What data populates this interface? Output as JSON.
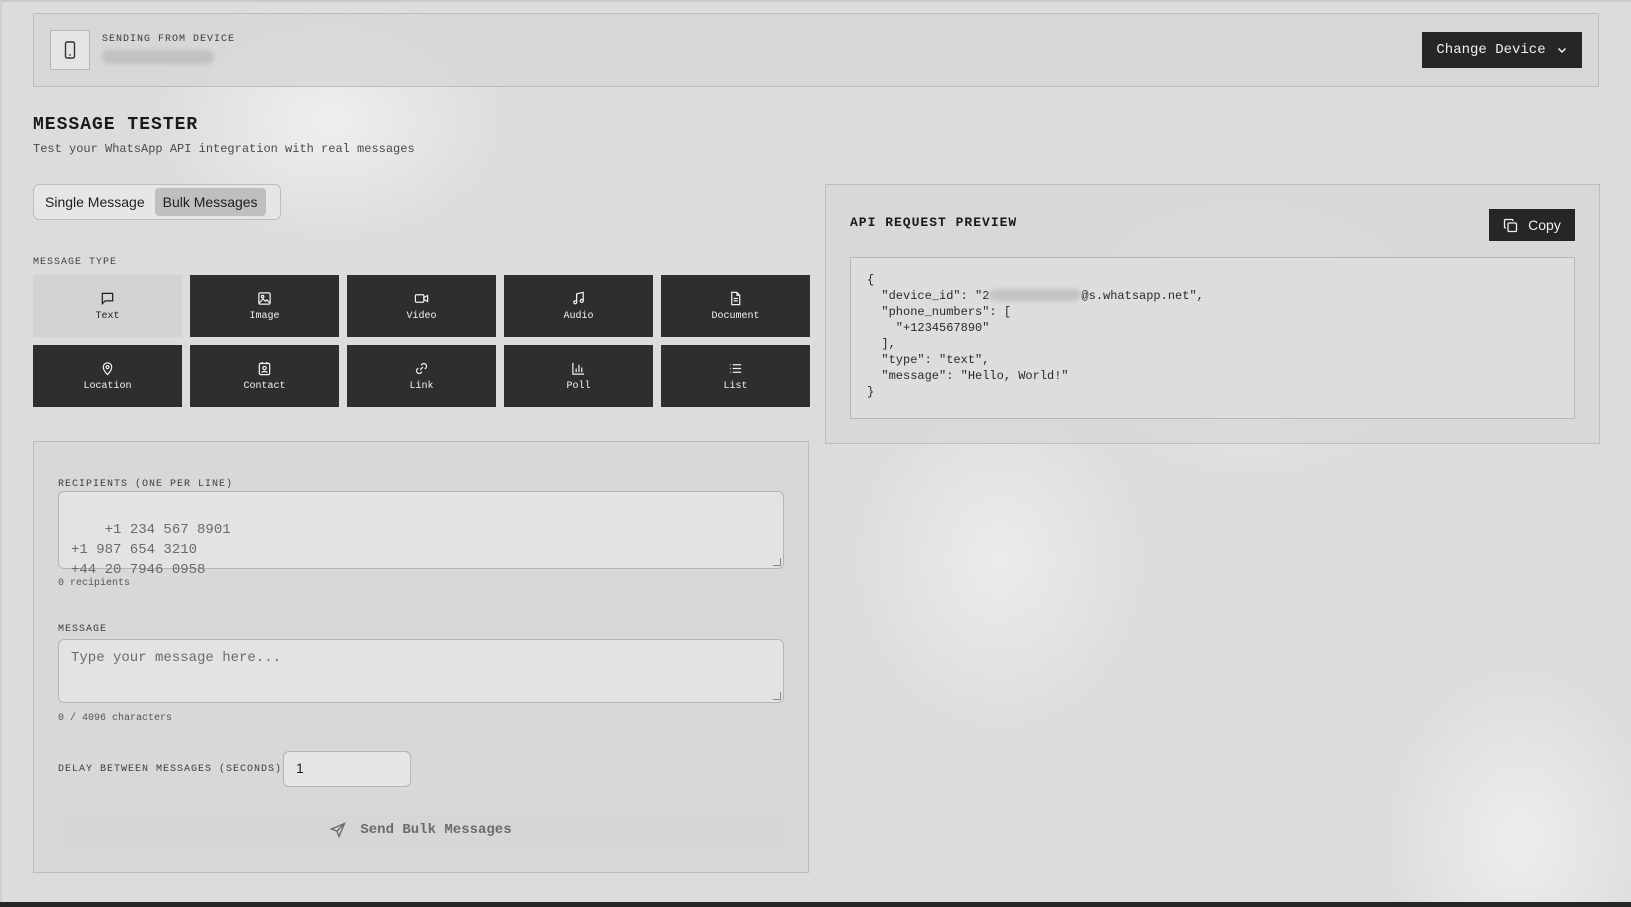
{
  "device": {
    "label": "SENDING FROM DEVICE",
    "change_button": "Change Device"
  },
  "header": {
    "title": "MESSAGE TESTER",
    "subtitle": "Test your WhatsApp API integration with real messages"
  },
  "mode": {
    "tabs": [
      {
        "label": "Single Message",
        "active": false
      },
      {
        "label": "Bulk Messages",
        "active": true
      }
    ]
  },
  "message_type": {
    "label": "MESSAGE TYPE",
    "options": [
      {
        "label": "Text",
        "icon": "message-square-icon",
        "active": true
      },
      {
        "label": "Image",
        "icon": "image-icon",
        "active": false
      },
      {
        "label": "Video",
        "icon": "video-icon",
        "active": false
      },
      {
        "label": "Audio",
        "icon": "music-icon",
        "active": false
      },
      {
        "label": "Document",
        "icon": "file-text-icon",
        "active": false
      },
      {
        "label": "Location",
        "icon": "map-pin-icon",
        "active": false
      },
      {
        "label": "Contact",
        "icon": "contact-icon",
        "active": false
      },
      {
        "label": "Link",
        "icon": "link-icon",
        "active": false
      },
      {
        "label": "Poll",
        "icon": "bar-chart-icon",
        "active": false
      },
      {
        "label": "List",
        "icon": "list-icon",
        "active": false
      }
    ]
  },
  "bulk": {
    "recipients_label": "RECIPIENTS (ONE PER LINE)",
    "recipients_placeholder": "+1 234 567 8901\n+1 987 654 3210\n+44 20 7946 0958",
    "recipients_count": "0 recipients",
    "message_label": "MESSAGE",
    "message_placeholder": "Type your message here...",
    "char_count": "0 / 4096 characters",
    "delay_label": "DELAY BETWEEN MESSAGES (SECONDS)",
    "delay_value": "1",
    "send_button": "Send Bulk Messages"
  },
  "preview": {
    "title": "API REQUEST PREVIEW",
    "copy_button": "Copy",
    "line_open": "{",
    "line_device_prefix": "  \"device_id\": \"2",
    "line_device_suffix": "@s.whatsapp.net\",",
    "line_phones": "  \"phone_numbers\": [",
    "line_phone_value": "    \"+1234567890\"",
    "line_phones_close": "  ],",
    "line_type": "  \"type\": \"text\",",
    "line_message": "  \"message\": \"Hello, World!\"",
    "line_close": "}"
  },
  "colors": {
    "background": "#dcdcdc",
    "dark_button": "#262626",
    "type_button": "#2e2e2e",
    "active_type": "#d3d3d3"
  }
}
